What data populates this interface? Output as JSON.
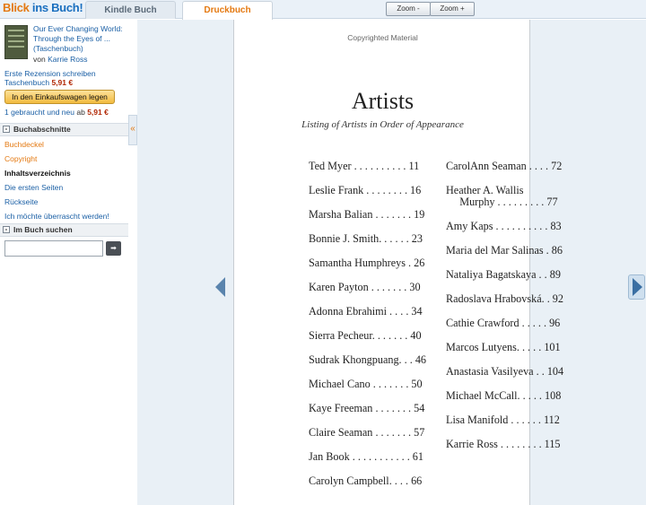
{
  "header": {
    "logo_part1": "Blick",
    "logo_part2": " ins Buch!",
    "tabs": [
      {
        "label": "Kindle Buch"
      },
      {
        "label": "Druckbuch"
      }
    ],
    "zoom_out_label": "Zoom -",
    "zoom_in_label": "Zoom +"
  },
  "sidebar": {
    "book_title": "Our Ever Changing World: Through the Eyes of ... (Taschenbuch)",
    "author_prefix": "von",
    "author_name": "Karrie Ross",
    "review_link": "Erste Rezension schreiben",
    "format": "Taschenbuch",
    "price": "5,91 €",
    "cart_button": "In den Einkaufswagen legen",
    "used_text": "1 gebraucht und neu",
    "used_from": "ab",
    "used_price": "5,91 €",
    "sections_heading": "Buchabschnitte",
    "sections": [
      {
        "label": "Buchdeckel"
      },
      {
        "label": "Copyright"
      },
      {
        "label": "Inhaltsverzeichnis"
      },
      {
        "label": "Die ersten Seiten"
      },
      {
        "label": "Rückseite"
      },
      {
        "label": "Ich möchte überrascht werden!"
      }
    ],
    "search_heading": "Im Buch suchen",
    "search_value": "",
    "search_go": "➡",
    "collapse_glyph": "«"
  },
  "page": {
    "copyright_notice": "Copyrighted Material",
    "heading": "Artists",
    "subheading": "Listing of Artists in Order of Appearance",
    "left_entries": [
      "Ted Myer . . . . . . . . . . 11",
      "Leslie Frank . . . . . . . . 16",
      "Marsha Balian . . . . . . . 19",
      "Bonnie J. Smith. . . . . . 23",
      "Samantha Humphreys . 26",
      "Karen Payton . . . . . . . 30",
      "Adonna Ebrahimi . . . . 34",
      "Sierra Pecheur. . . . . . . 40",
      "Sudrak Khongpuang. . . 46",
      "Michael Cano . . . . . . . 50",
      "Kaye Freeman . . . . . . . 54",
      "Claire Seaman . . . . . . . 57",
      "Jan Book . . . . . . . . . . . 61",
      "Carolyn Campbell. . . . 66"
    ],
    "right_entries": [
      "CarolAnn Seaman . . . . 72",
      "Heather A. Wallis",
      "     Murphy . . . . . . . . . 77",
      "Amy Kaps . . . . . . . . . . 83",
      "Maria del Mar Salinas . 86",
      "Nataliya Bagatskaya . . 89",
      "Radoslava Hrabovská. . 92",
      "Cathie Crawford . . . . . 96",
      "Marcos Lutyens. . . . . 101",
      "Anastasia Vasilyeva . . 104",
      "Michael McCall. . . . . 108",
      "Lisa Manifold . . . . . . 112",
      "Karrie Ross . . . . . . . . 115"
    ]
  }
}
